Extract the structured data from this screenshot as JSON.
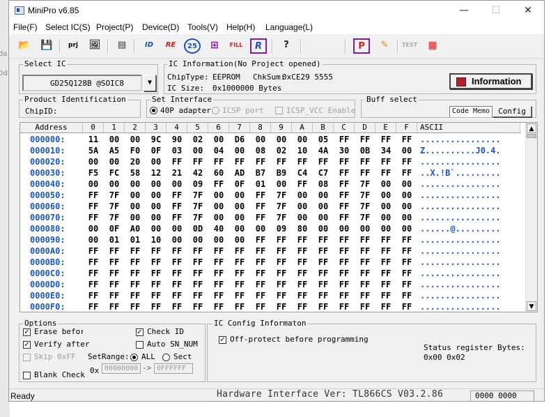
{
  "window": {
    "title": "MiniPro v6.85",
    "minimize": "—",
    "maximize": "☐",
    "close": "✕"
  },
  "bg": {
    "left_text_1": "da",
    "left_text_2": "0d"
  },
  "menu": [
    "File(F)",
    "Select IC(S)",
    "Project(P)",
    "Device(D)",
    "Tools(V)",
    "Help(H)",
    "Language(L)"
  ],
  "toolbar": {
    "buttons": [
      {
        "name": "open-icon",
        "glyph": "📂"
      },
      {
        "name": "save-icon",
        "glyph": "💾"
      },
      {
        "name": "project-icon",
        "glyph": "prj"
      },
      {
        "name": "load-image-icon",
        "glyph": "🖼"
      },
      {
        "name": "chip-save-icon",
        "glyph": "▤"
      },
      {
        "name": "read-id-icon",
        "glyph": "ID"
      },
      {
        "name": "read-icon",
        "glyph": "RE"
      },
      {
        "name": "verify-icon",
        "glyph": "25"
      },
      {
        "name": "blank-check-icon",
        "glyph": "⊞"
      },
      {
        "name": "fill-icon",
        "glyph": "FILL"
      },
      {
        "name": "read-chip-icon",
        "glyph": "R"
      },
      {
        "name": "help-icon",
        "glyph": "?"
      },
      {
        "name": "program-icon",
        "glyph": "P"
      },
      {
        "name": "edit-icon",
        "glyph": "✎"
      },
      {
        "name": "test-icon",
        "glyph": "TEST"
      },
      {
        "name": "chip-icon",
        "glyph": "▦"
      }
    ]
  },
  "select_ic": {
    "title": "Select IC",
    "value": "GD25Q128B @SOIC8"
  },
  "ic_info": {
    "title": "IC Information(No Project opened)",
    "chip_type_label": "ChipType:",
    "chip_type": "EEPROM",
    "chksum_label": "ChkSum:",
    "chksum": "0xCE29 5555",
    "size_label": "IC Size:",
    "size": "0x1000000 Bytes",
    "info_button": "Information"
  },
  "product_id": {
    "title": "Product Identification",
    "chip_id_label": "ChipID:"
  },
  "set_interface": {
    "title": "Set Interface",
    "adapter_40p": "40P adapter",
    "icsp_port": "ICSP port",
    "icsp_vcc": "ICSP_VCC Enable"
  },
  "buff_select": {
    "title": "Buff select",
    "code_memo": "Code Memo",
    "config": "Config"
  },
  "hex": {
    "headers": [
      "Address",
      "0",
      "1",
      "2",
      "3",
      "4",
      "5",
      "6",
      "7",
      "8",
      "9",
      "A",
      "B",
      "C",
      "D",
      "E",
      "F",
      "ASCII"
    ],
    "rows": [
      {
        "addr": "000000:",
        "bytes": [
          "11",
          "00",
          "00",
          "9C",
          "90",
          "02",
          "00",
          "D6",
          "00",
          "00",
          "00",
          "05",
          "FF",
          "FF",
          "FF",
          "FF"
        ],
        "ascii": "................"
      },
      {
        "addr": "000010:",
        "bytes": [
          "5A",
          "A5",
          "F0",
          "0F",
          "03",
          "00",
          "04",
          "00",
          "08",
          "02",
          "10",
          "4A",
          "30",
          "0B",
          "34",
          "00"
        ],
        "ascii": "Z..........J0.4."
      },
      {
        "addr": "000020:",
        "bytes": [
          "00",
          "00",
          "20",
          "00",
          "FF",
          "FF",
          "FF",
          "FF",
          "FF",
          "FF",
          "FF",
          "FF",
          "FF",
          "FF",
          "FF",
          "FF"
        ],
        "ascii": "................"
      },
      {
        "addr": "000030:",
        "bytes": [
          "F5",
          "FC",
          "58",
          "12",
          "21",
          "42",
          "60",
          "AD",
          "B7",
          "B9",
          "C4",
          "C7",
          "FF",
          "FF",
          "FF",
          "FF"
        ],
        "ascii": "..X.!B`........."
      },
      {
        "addr": "000040:",
        "bytes": [
          "00",
          "00",
          "00",
          "00",
          "00",
          "09",
          "FF",
          "0F",
          "01",
          "00",
          "FF",
          "08",
          "FF",
          "7F",
          "00",
          "00"
        ],
        "ascii": "................"
      },
      {
        "addr": "000050:",
        "bytes": [
          "FF",
          "7F",
          "00",
          "00",
          "FF",
          "7F",
          "00",
          "00",
          "FF",
          "7F",
          "00",
          "00",
          "FF",
          "7F",
          "00",
          "00"
        ],
        "ascii": "................"
      },
      {
        "addr": "000060:",
        "bytes": [
          "FF",
          "7F",
          "00",
          "00",
          "FF",
          "7F",
          "00",
          "00",
          "FF",
          "7F",
          "00",
          "00",
          "FF",
          "7F",
          "00",
          "00"
        ],
        "ascii": "................"
      },
      {
        "addr": "000070:",
        "bytes": [
          "FF",
          "7F",
          "00",
          "00",
          "FF",
          "7F",
          "00",
          "00",
          "FF",
          "7F",
          "00",
          "00",
          "FF",
          "7F",
          "00",
          "00"
        ],
        "ascii": "................"
      },
      {
        "addr": "000080:",
        "bytes": [
          "00",
          "0F",
          "A0",
          "00",
          "00",
          "0D",
          "40",
          "00",
          "00",
          "09",
          "80",
          "00",
          "00",
          "00",
          "00",
          "00"
        ],
        "ascii": "......@........."
      },
      {
        "addr": "000090:",
        "bytes": [
          "00",
          "01",
          "01",
          "10",
          "00",
          "00",
          "00",
          "00",
          "FF",
          "FF",
          "FF",
          "FF",
          "FF",
          "FF",
          "FF",
          "FF"
        ],
        "ascii": "................"
      },
      {
        "addr": "0000A0:",
        "bytes": [
          "FF",
          "FF",
          "FF",
          "FF",
          "FF",
          "FF",
          "FF",
          "FF",
          "FF",
          "FF",
          "FF",
          "FF",
          "FF",
          "FF",
          "FF",
          "FF"
        ],
        "ascii": "................"
      },
      {
        "addr": "0000B0:",
        "bytes": [
          "FF",
          "FF",
          "FF",
          "FF",
          "FF",
          "FF",
          "FF",
          "FF",
          "FF",
          "FF",
          "FF",
          "FF",
          "FF",
          "FF",
          "FF",
          "FF"
        ],
        "ascii": "................"
      },
      {
        "addr": "0000C0:",
        "bytes": [
          "FF",
          "FF",
          "FF",
          "FF",
          "FF",
          "FF",
          "FF",
          "FF",
          "FF",
          "FF",
          "FF",
          "FF",
          "FF",
          "FF",
          "FF",
          "FF"
        ],
        "ascii": "................"
      },
      {
        "addr": "0000D0:",
        "bytes": [
          "FF",
          "FF",
          "FF",
          "FF",
          "FF",
          "FF",
          "FF",
          "FF",
          "FF",
          "FF",
          "FF",
          "FF",
          "FF",
          "FF",
          "FF",
          "FF"
        ],
        "ascii": "................"
      },
      {
        "addr": "0000E0:",
        "bytes": [
          "FF",
          "FF",
          "FF",
          "FF",
          "FF",
          "FF",
          "FF",
          "FF",
          "FF",
          "FF",
          "FF",
          "FF",
          "FF",
          "FF",
          "FF",
          "FF"
        ],
        "ascii": "................"
      },
      {
        "addr": "0000F0:",
        "bytes": [
          "FF",
          "FF",
          "FF",
          "FF",
          "FF",
          "FF",
          "FF",
          "FF",
          "FF",
          "FF",
          "FF",
          "FF",
          "FF",
          "FF",
          "FF",
          "FF"
        ],
        "ascii": "................"
      }
    ]
  },
  "options": {
    "title": "Options",
    "erase_before": "Erase before",
    "verify_after": "Verify after",
    "skip_0xff": "Skip 0xFF",
    "blank_check": "Blank Check",
    "check_id": "Check ID",
    "auto_sn_num": "Auto SN_NUM",
    "set_range_label": "SetRange:",
    "all": "ALL",
    "sect": "Sect",
    "ox": "0x",
    "range_start": "00000000",
    "arrow": "->",
    "range_end": "0FFFFFF"
  },
  "ic_config": {
    "title": "IC Config Informaton",
    "off_protect": "Off-protect before programming",
    "status_reg_label": "Status register Bytes:",
    "status_reg_value": "0x00 0x02"
  },
  "statusbar": {
    "ready": "Ready",
    "hw_version": "Hardware Interface Ver: TL866CS V03.2.86",
    "counter": "0000 0000"
  }
}
